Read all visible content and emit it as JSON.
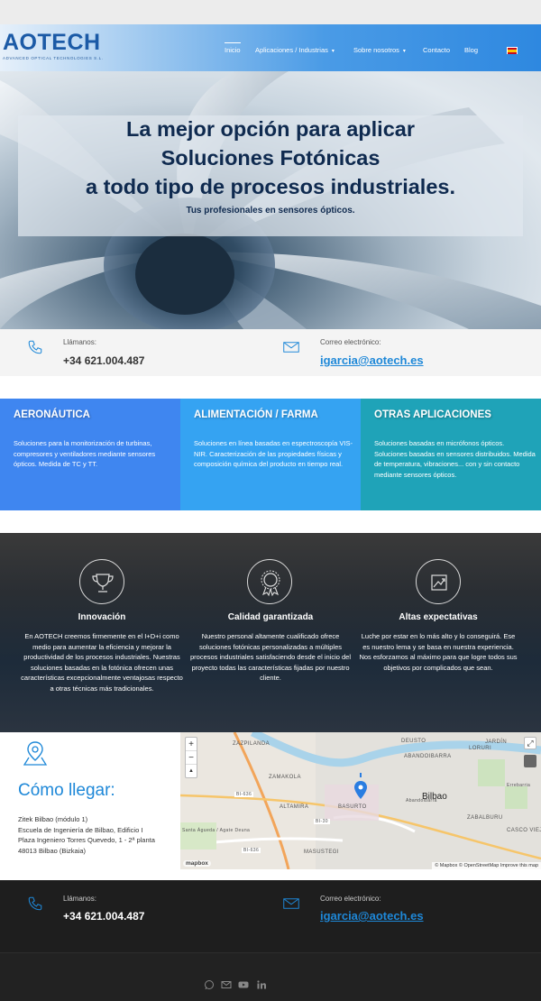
{
  "header": {
    "logo": "AOTECH",
    "logo_sub": "ADVANCED OPTICAL TECHNOLOGIES S.L.",
    "nav": [
      {
        "label": "Inicio",
        "active": true
      },
      {
        "label": "Aplicaciones / Industrias",
        "dropdown": true
      },
      {
        "label": "Sobre nosotros",
        "dropdown": true
      },
      {
        "label": "Contacto"
      },
      {
        "label": "Blog"
      }
    ],
    "language_icon": "spain-flag-icon"
  },
  "hero": {
    "title_line1": "La mejor opción para aplicar",
    "title_line2": "Soluciones Fotónicas",
    "title_line3": "a todo tipo de procesos industriales.",
    "subtitle": "Tus profesionales en sensores ópticos."
  },
  "contact": {
    "phone_label": "Llámanos:",
    "phone": "+34 621.004.487",
    "email_label": "Correo electrónico:",
    "email": "igarcia@aotech.es"
  },
  "cards": [
    {
      "title": "AERONÁUTICA",
      "color": "#3f86f0",
      "text": "Soluciones para la monitorización de turbinas, compresores y ventiladores mediante sensores ópticos. Medida de TC y TT."
    },
    {
      "title": "ALIMENTACIÓN / FARMA",
      "color": "#35a3f2",
      "text": "Soluciones en línea basadas en espectroscopía VIS-NIR. Caracterización de las propiedades físicas y composición química del producto en tiempo real."
    },
    {
      "title": "OTRAS APLICACIONES",
      "color": "#1fa3b8",
      "text": "Soluciones basadas en micrófonos ópticos. Soluciones basadas en sensores distribuidos. Medida de temperatura, vibraciones... con y sin contacto mediante sensores ópticos."
    }
  ],
  "features": [
    {
      "icon": "trophy-icon",
      "title": "Innovación",
      "text": "En AOTECH creemos firmemente en el I+D+i como medio para aumentar la eficiencia y mejorar la productividad de los procesos industriales. Nuestras soluciones basadas en la fotónica ofrecen unas características excepcionalmente ventajosas respecto a otras técnicas más tradicionales."
    },
    {
      "icon": "award-medal-icon",
      "title": "Calidad garantizada",
      "text": "Nuestro personal altamente cualificado ofrece soluciones fotónicas personalizadas a múltiples procesos industriales satisfaciendo desde el inicio del proyecto todas las características fijadas por nuestro cliente."
    },
    {
      "icon": "growth-chart-icon",
      "title": "Altas expectativas",
      "text": "Luche por estar en lo más alto y lo conseguirá. Ese es nuestro lema y se basa en nuestra experiencia. Nos esforzamos al máximo para que logre todos sus objetivos por complicados que sean."
    }
  ],
  "location": {
    "title": "Cómo llegar:",
    "address_lines": [
      "Zitek Bilbao (módulo 1)",
      "Escuela de Ingeniería de Bilbao, Edificio I",
      "Plaza Ingeniero Torres Quevedo, 1 - 2ª planta",
      "48013 Bilbao (Bizkaia)"
    ]
  },
  "map": {
    "labels": [
      "ZAZPILANDA",
      "DEUSTO",
      "ABANDOIBARRA",
      "ZAMAKOLA",
      "ALTAMIRA",
      "BASURTO",
      "Bilbao",
      "MASUSTEGI",
      "ZABALBURU",
      "CASCO VIEJO",
      "Santa Águeda / Agate Deuna",
      "JARDÍN",
      "LORURI",
      "Abandoibarra",
      "Errebarria"
    ],
    "roads": [
      "BI-636",
      "BI-30",
      "BI-636"
    ],
    "zoom_in": "+",
    "zoom_out": "−",
    "compass": "▲",
    "logo": "mapbox",
    "attribution": "© Mapbox © OpenStreetMap  Improve this map"
  },
  "footer": {
    "social_icons": [
      "whatsapp-icon",
      "mail-icon",
      "youtube-icon",
      "linkedin-icon"
    ]
  }
}
